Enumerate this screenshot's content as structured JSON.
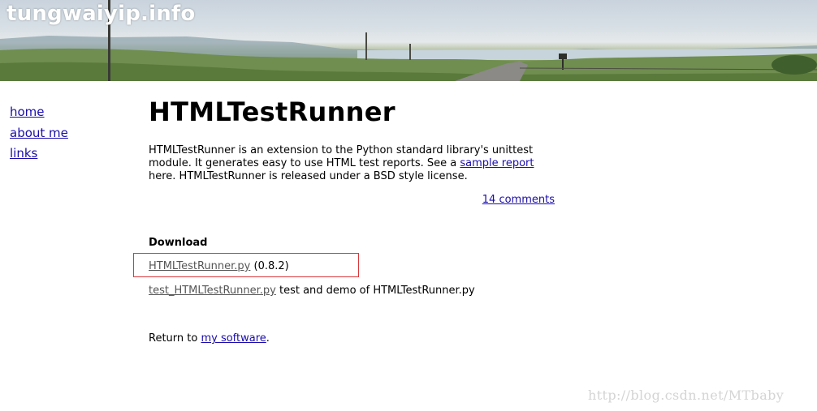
{
  "header": {
    "site_title": "tungwaiyip.info"
  },
  "nav": {
    "items": [
      {
        "label": "home"
      },
      {
        "label": "about me"
      },
      {
        "label": "links"
      }
    ]
  },
  "main": {
    "title": "HTMLTestRunner",
    "intro_part1": "HTMLTestRunner is an extension to the Python standard library's unittest module. It generates easy to use HTML test reports. See a ",
    "intro_link": "sample report",
    "intro_part2": " here. HTMLTestRunner is released under a BSD style license.",
    "comments_link": "14 comments",
    "download_heading": "Download",
    "files": [
      {
        "link": "HTMLTestRunner.py",
        "note": " (0.8.2)"
      },
      {
        "link": "test_HTMLTestRunner.py",
        "note": " test and demo of HTMLTestRunner.py"
      }
    ],
    "return_prefix": "Return to ",
    "return_link": "my software",
    "return_suffix": "."
  },
  "watermark": "http://blog.csdn.net/MTbaby",
  "colors": {
    "link": "#1a0dab",
    "file_link": "#555555",
    "highlight_border": "#d9383a"
  }
}
